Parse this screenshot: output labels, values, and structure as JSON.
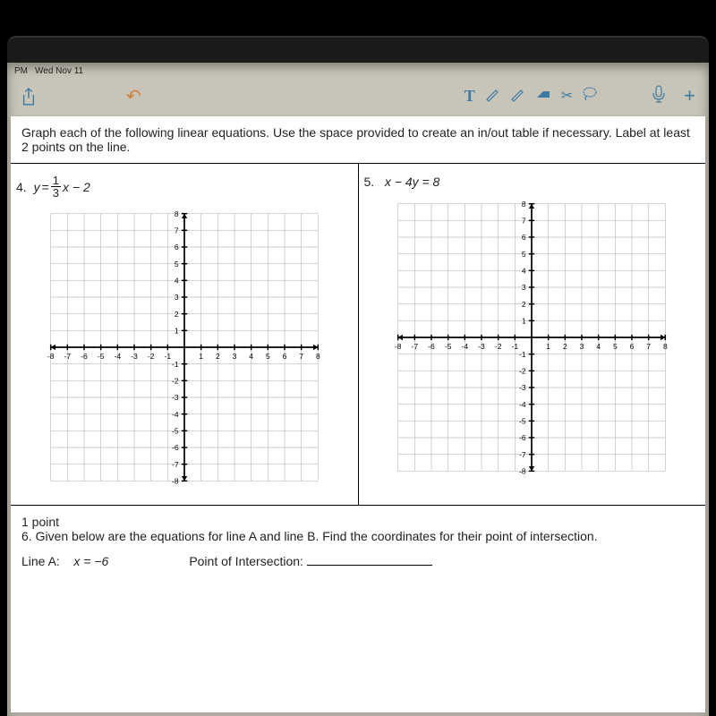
{
  "statusbar": {
    "left": "PM",
    "date": "Wed Nov 11"
  },
  "toolbar": {
    "icons": [
      "share-icon",
      "undo-icon",
      "text-tool",
      "pen-tool",
      "pencil-tool",
      "eraser-tool",
      "scissors-tool",
      "paint-tool",
      "mic-icon",
      "plus-icon"
    ]
  },
  "instructions": "Graph each of the following linear equations. Use the space provided to create an in/out table if necessary. Label at least 2 points on the line.",
  "problems": {
    "p4": {
      "number": "4.",
      "var": "y",
      "eq_prefix": " = ",
      "frac_num": "1",
      "frac_den": "3",
      "eq_suffix": "x − 2"
    },
    "p5": {
      "number": "5.",
      "text": "x − 4y = 8"
    }
  },
  "q6": {
    "points": "1 point",
    "text": "6. Given below are the equations for line A and line B. Find the coordinates for their point of intersection.",
    "lineA_label": "Line A:",
    "lineA_eq": "x = −6",
    "poi_label": "Point of Intersection:"
  },
  "chart_data": [
    {
      "type": "grid",
      "title": "Problem 4 blank coordinate grid",
      "x_ticks": [
        -8,
        -7,
        -6,
        -5,
        -4,
        -3,
        -2,
        -1,
        1,
        2,
        3,
        4,
        5,
        6,
        7,
        8
      ],
      "y_ticks": [
        -8,
        -7,
        -6,
        -5,
        -4,
        -3,
        -2,
        -1,
        1,
        2,
        3,
        4,
        5,
        6,
        7,
        8
      ],
      "xlim": [
        -8,
        8
      ],
      "ylim": [
        -8,
        8
      ],
      "series": []
    },
    {
      "type": "grid",
      "title": "Problem 5 blank coordinate grid",
      "x_ticks": [
        -8,
        -7,
        -6,
        -5,
        -4,
        -3,
        -2,
        -1,
        1,
        2,
        3,
        4,
        5,
        6,
        7,
        8
      ],
      "y_ticks": [
        -8,
        -7,
        -6,
        -5,
        -4,
        -3,
        -2,
        -1,
        1,
        2,
        3,
        4,
        5,
        6,
        7,
        8
      ],
      "xlim": [
        -8,
        8
      ],
      "ylim": [
        -8,
        8
      ],
      "series": []
    }
  ]
}
